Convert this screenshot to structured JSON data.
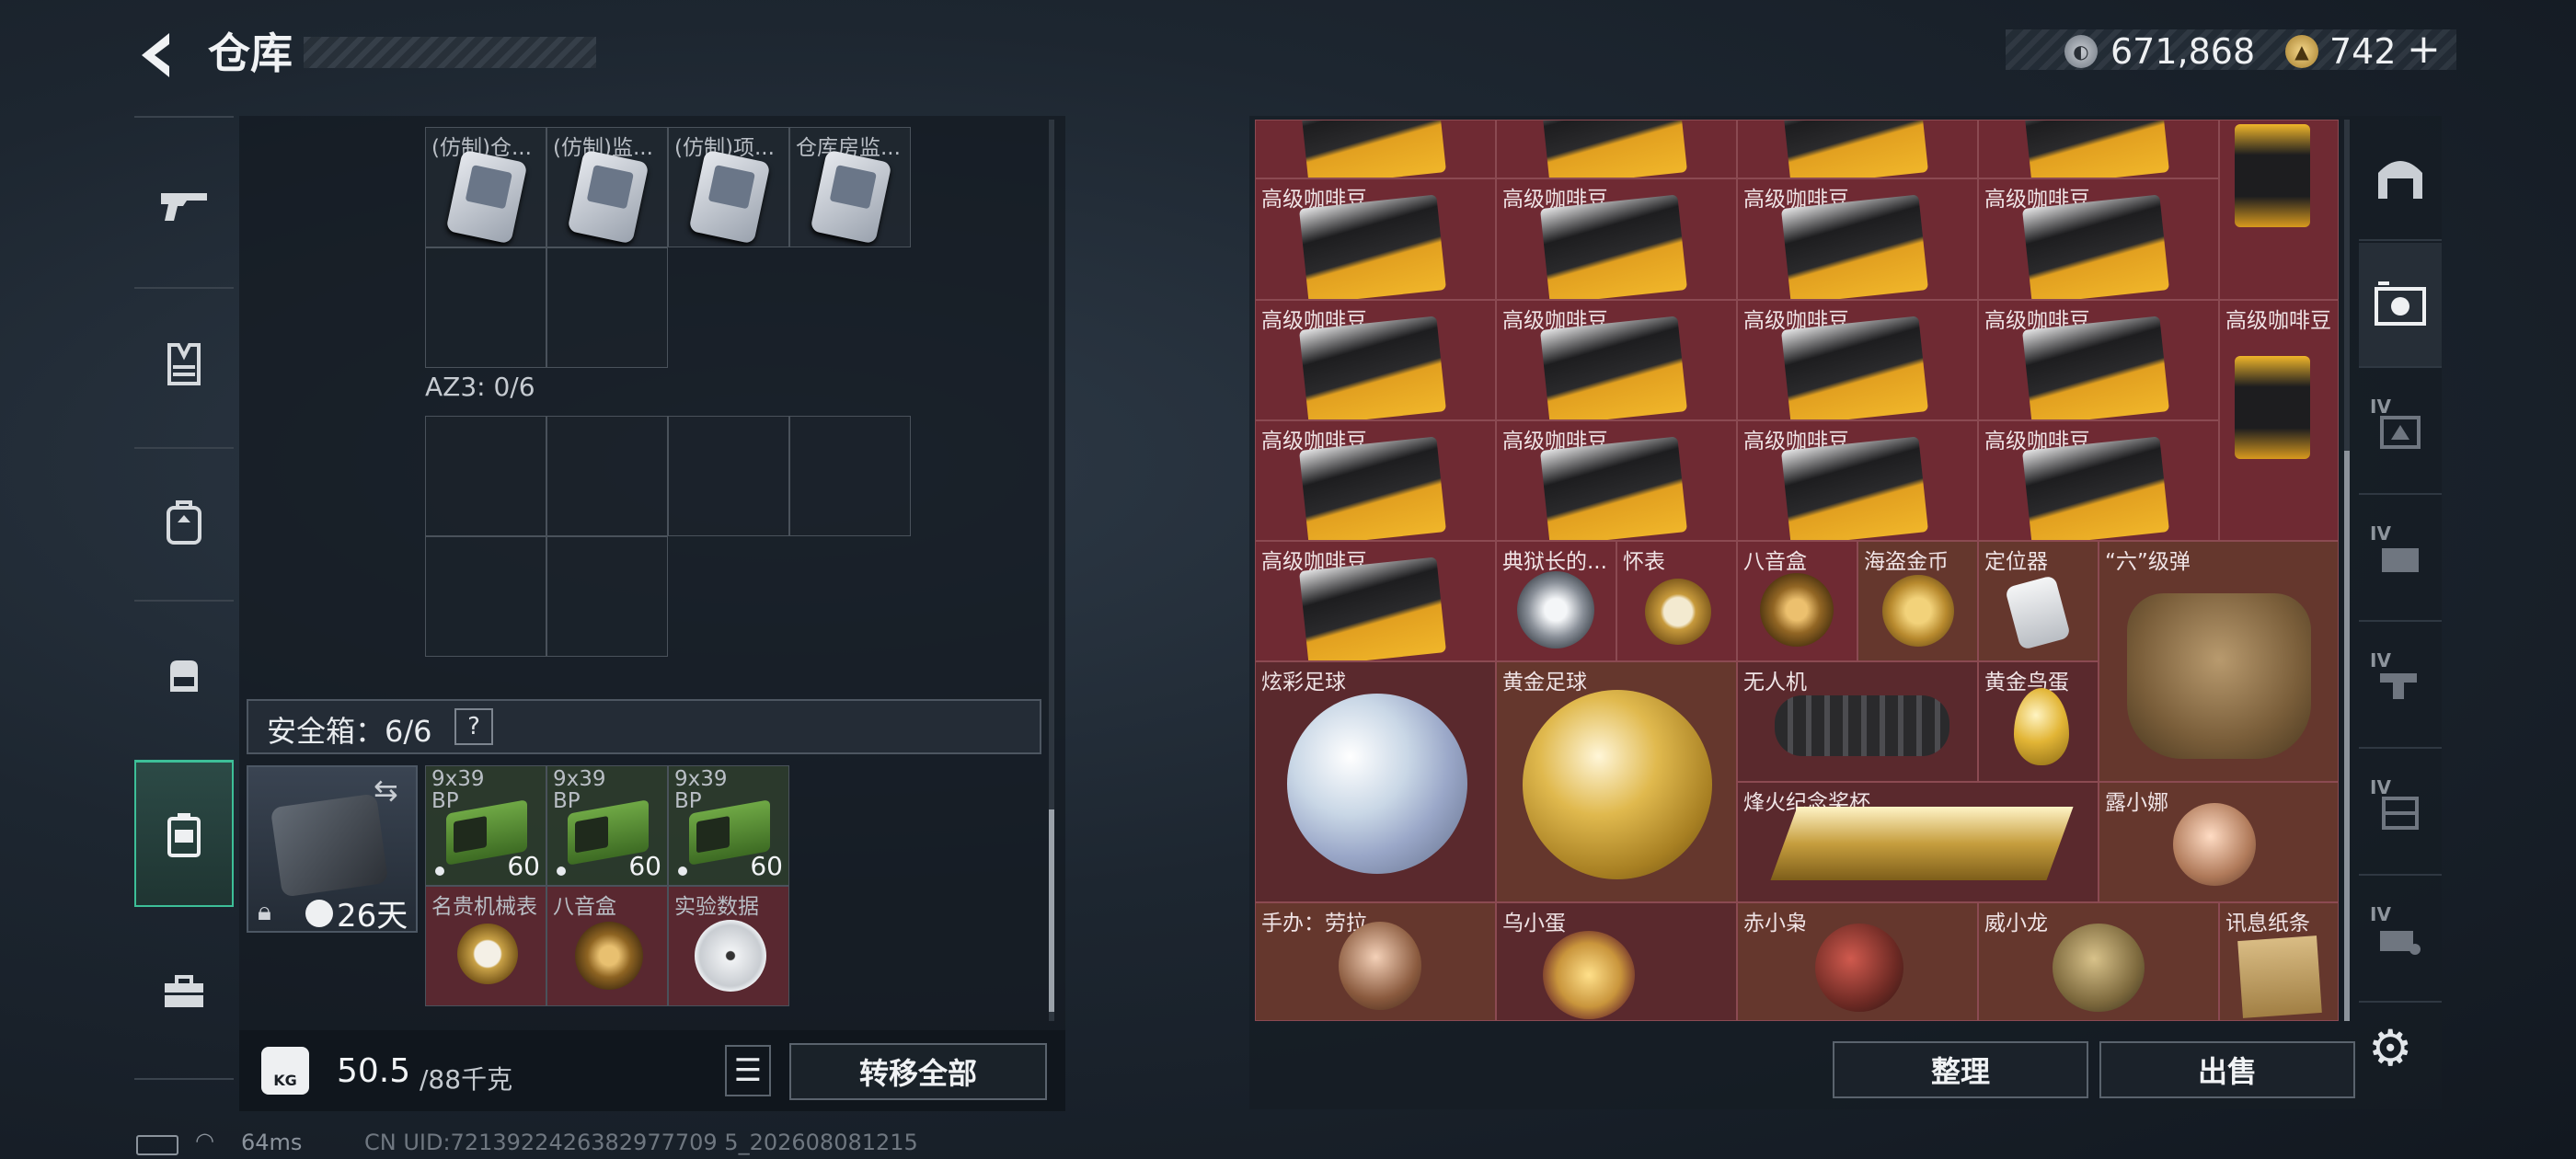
{
  "header": {
    "title": "仓库"
  },
  "currency": {
    "silver": "671,868",
    "gold": "742",
    "plus": "+"
  },
  "left_panel": {
    "equip_labels": [
      "(仿制)仓...",
      "(仿制)监...",
      "(仿制)项...",
      "仓库房监..."
    ],
    "az3_label": "AZ3: 0/6",
    "safebox": {
      "label": "安全箱：6/6",
      "help": "?",
      "days": "26天"
    },
    "safe_items": [
      {
        "name": "9x39 BP",
        "qty": "60"
      },
      {
        "name": "9x39 BP",
        "qty": "60"
      },
      {
        "name": "9x39 BP",
        "qty": "60"
      },
      {
        "name": "名贵机械表"
      },
      {
        "name": "八音盒"
      },
      {
        "name": "实验数据"
      }
    ],
    "weight": {
      "current": "50.5",
      "max": "/88千克",
      "icon": "KG"
    },
    "transfer_label": "转移全部"
  },
  "stash": {
    "coffee": "高级咖啡豆",
    "items": [
      "典狱长的...",
      "怀表",
      "八音盒",
      "海盗金币",
      "定位器",
      "“六”级弹",
      "炫彩足球",
      "黄金足球",
      "无人机",
      "黄金鸟蛋",
      "烽火纪念奖杯",
      "露小娜",
      "手办：劳拉",
      "乌小蛋",
      "赤小枭",
      "威小龙",
      "讯息纸条"
    ]
  },
  "buttons": {
    "organize": "整理",
    "sell": "出售"
  },
  "status": {
    "ping": "64ms",
    "uid": "CN UID:7213922426382977709 5_202608081215"
  },
  "icons": [
    "back-arrow-icon",
    "silver-coin-icon",
    "gold-coin-icon",
    "gun-icon",
    "vest-icon",
    "backpack-icon",
    "bag-icon",
    "safebox-icon",
    "toolbox-icon",
    "swap-icon",
    "lock-icon",
    "clock-icon",
    "list-icon",
    "gear-icon",
    "battery-icon",
    "wifi-icon"
  ],
  "colors": {
    "accent": "#3dbf98",
    "stash_bg": "#6f2a33"
  }
}
